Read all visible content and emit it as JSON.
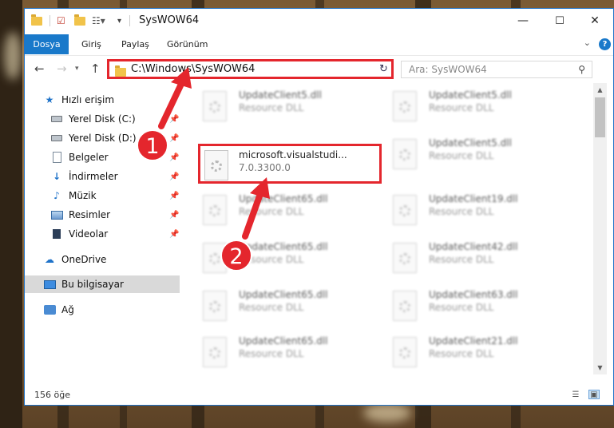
{
  "window": {
    "title": "SysWOW64",
    "controls": {
      "minimize": "—",
      "maximize": "☐",
      "close": "✕"
    }
  },
  "ribbon": {
    "tabs": [
      {
        "label": "Dosya",
        "active": true
      },
      {
        "label": "Giriş"
      },
      {
        "label": "Paylaş"
      },
      {
        "label": "Görünüm"
      }
    ],
    "help": "?"
  },
  "address": {
    "path": "C:\\Windows\\SysWOW64",
    "search_placeholder": "Ara: SysWOW64"
  },
  "sidebar": {
    "items": [
      {
        "label": "Hızlı erişim",
        "icon": "star-icon",
        "pinned": false
      },
      {
        "label": "Yerel Disk (C:)",
        "icon": "drive-icon",
        "pinned": true
      },
      {
        "label": "Yerel Disk (D:)",
        "icon": "drive-icon",
        "pinned": true
      },
      {
        "label": "Belgeler",
        "icon": "document-icon",
        "pinned": true
      },
      {
        "label": "İndirmeler",
        "icon": "download-icon",
        "pinned": true
      },
      {
        "label": "Müzik",
        "icon": "music-icon",
        "pinned": true
      },
      {
        "label": "Resimler",
        "icon": "picture-icon",
        "pinned": true
      },
      {
        "label": "Videolar",
        "icon": "video-icon",
        "pinned": true
      },
      {
        "label": "OneDrive",
        "icon": "cloud-icon",
        "pinned": false
      },
      {
        "label": "Bu bilgisayar",
        "icon": "computer-icon",
        "pinned": false,
        "selected": true
      },
      {
        "label": "Ağ",
        "icon": "network-icon",
        "pinned": false
      }
    ]
  },
  "files": [
    {
      "name": "UpdateClient5.dll",
      "desc": "Resource DLL"
    },
    {
      "name": "UpdateClient5.dll",
      "desc": "Resource DLL"
    },
    {
      "name": "microsoft.visualstudi...",
      "desc": "7.0.3300.0",
      "highlighted": true
    },
    {
      "name": "UpdateClient5.dll",
      "desc": "Resource DLL"
    },
    {
      "name": "UpdateClient65.dll",
      "desc": "Resource DLL"
    },
    {
      "name": "UpdateClient19.dll",
      "desc": "Resource DLL"
    },
    {
      "name": "UpdateClient65.dll",
      "desc": "Resource DLL"
    },
    {
      "name": "UpdateClient42.dll",
      "desc": "Resource DLL"
    },
    {
      "name": "UpdateClient65.dll",
      "desc": "Resource DLL"
    },
    {
      "name": "UpdateClient63.dll",
      "desc": "Resource DLL"
    },
    {
      "name": "UpdateClient65.dll",
      "desc": "Resource DLL"
    },
    {
      "name": "UpdateClient21.dll",
      "desc": "Resource DLL"
    }
  ],
  "status": {
    "count": "156 öğe"
  },
  "annotations": {
    "step1": "1",
    "step2": "2",
    "color": "#e4262d"
  }
}
